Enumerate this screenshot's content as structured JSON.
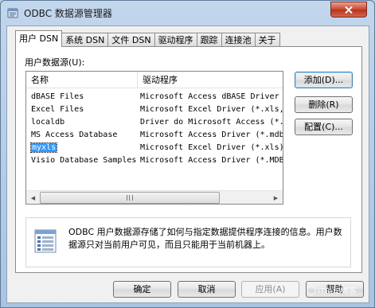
{
  "window": {
    "title": "ODBC 数据源管理器",
    "close_glyph": "✕"
  },
  "tabs": [
    {
      "label": "用户 DSN",
      "active": true
    },
    {
      "label": "系统 DSN"
    },
    {
      "label": "文件 DSN"
    },
    {
      "label": "驱动程序"
    },
    {
      "label": "跟踪"
    },
    {
      "label": "连接池"
    },
    {
      "label": "关于"
    }
  ],
  "user_dsn": {
    "group_label": "用户数据源(U):",
    "columns": [
      "名称",
      "驱动程序"
    ],
    "rows": [
      {
        "name": "dBASE Files",
        "driver": "Microsoft Access dBASE Driver"
      },
      {
        "name": "Excel Files",
        "driver": "Microsoft Excel Driver (*.xls,"
      },
      {
        "name": "localdb",
        "driver": "Driver do Microsoft Access (*."
      },
      {
        "name": "MS Access Database",
        "driver": "Microsoft Access Driver (*.mdb"
      },
      {
        "name": "myxls",
        "driver": "Microsoft Excel Driver (*.xls)",
        "selected": true
      },
      {
        "name": "Visio Database Samples",
        "driver": "Microsoft Access Driver (*.MDB"
      }
    ],
    "scroll_left_glyph": "◀",
    "scroll_right_glyph": "▶"
  },
  "side_buttons": {
    "add": "添加(D)...",
    "remove": "删除(R)",
    "configure": "配置(C)..."
  },
  "info": {
    "text": "ODBC 用户数据源存储了如何与指定数据提供程序连接的信息。用户数据源只对当前用户可见，而且只能用于当前机器上。"
  },
  "bottom_buttons": {
    "ok": "确定",
    "cancel": "取消",
    "apply": "应用(A)",
    "help": "帮助"
  },
  "watermark": {
    "text": "ITPUB博客"
  },
  "colors": {
    "selection": "#3399ff",
    "frame": "#b9d1ea",
    "close_button": "#c9452f"
  },
  "icons": {
    "app": "odbc-database-icon",
    "info": "document-list-icon",
    "close": "close-icon"
  }
}
